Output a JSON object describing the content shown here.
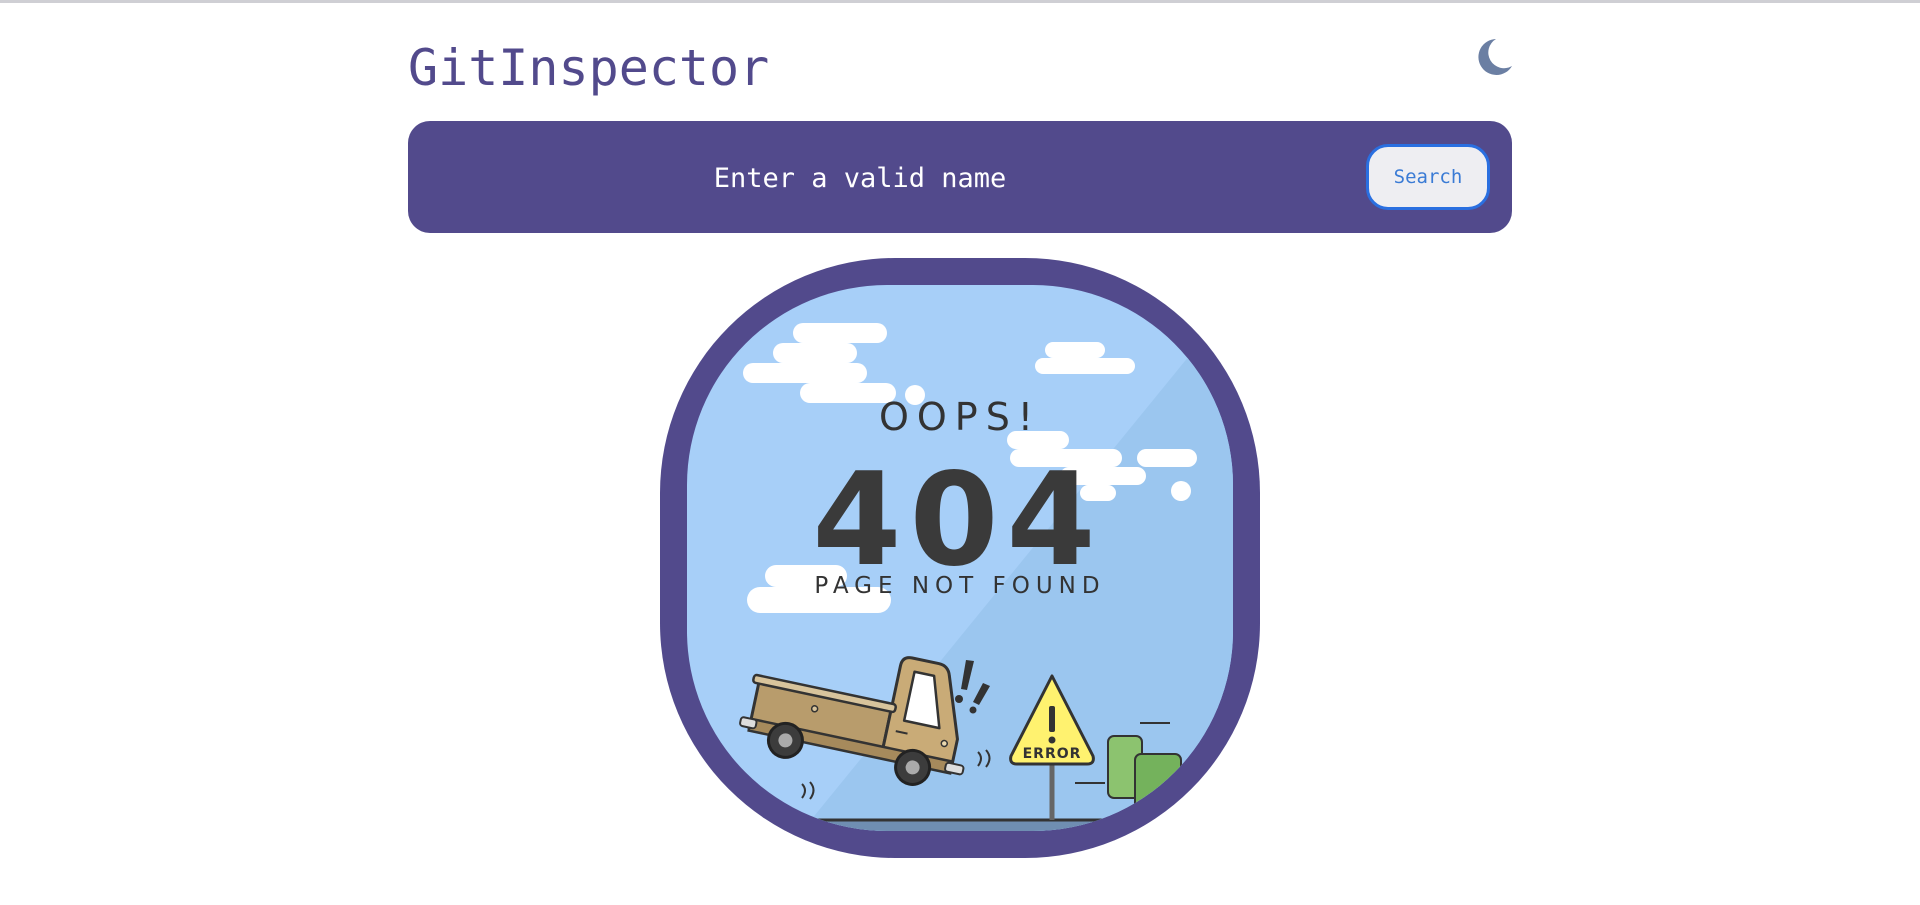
{
  "app": {
    "title": "GitInspector"
  },
  "header": {
    "theme_toggle_icon": "moon-icon",
    "theme_toggle_color": "#6b7fa3"
  },
  "search": {
    "placeholder": "Enter a valid name",
    "button_label": "Search"
  },
  "error": {
    "oops": "OOPS!",
    "code": "404",
    "message": "PAGE NOT FOUND",
    "sign_label": "ERROR"
  },
  "colors": {
    "brand": "#524a8c",
    "sky": "#a7cff8",
    "button_border": "#2a6fe0"
  }
}
